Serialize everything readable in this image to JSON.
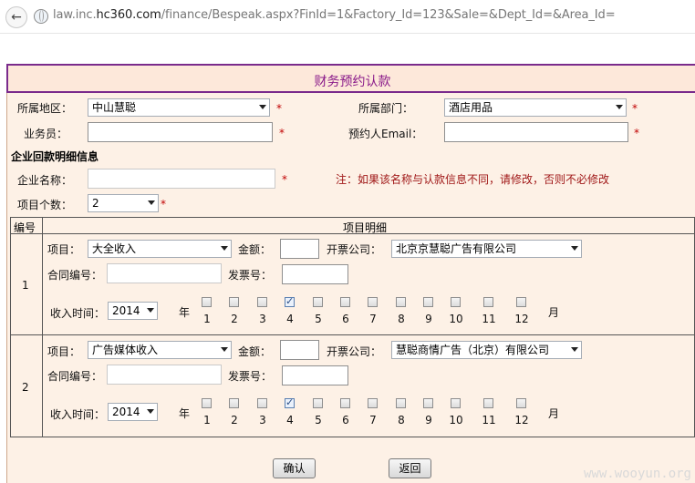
{
  "browser": {
    "url_prefix": "law.inc.",
    "url_domain": "hc360.com",
    "url_path": "/finance/Bespeak.aspx?FinId=1&Factory_Id=123&Sale=&Dept_Id=&Area_Id="
  },
  "form": {
    "title": "财务预约认款",
    "area_label": "所属地区：",
    "area_value": "中山慧聪",
    "dept_label": "所属部门：",
    "dept_value": "酒店用品",
    "sales_label": "业务员：",
    "email_label": "预约人Email：",
    "required_mark": "*",
    "section_title": "企业回款明细信息",
    "company_label": "企业名称：",
    "company_note": "注：如果该名称与认款信息不同，请修改，否则不必修改",
    "count_label": "项目个数：",
    "count_value": "2"
  },
  "table": {
    "col_no": "编号",
    "col_detail": "项目明细",
    "labels": {
      "project": "项目：",
      "amount": "金额：",
      "invoice_company": "开票公司：",
      "contract_no": "合同编号：",
      "invoice_no": "发票号：",
      "income_time": "收入时间：",
      "year": "年",
      "month": "月"
    },
    "months": [
      "1",
      "2",
      "3",
      "4",
      "5",
      "6",
      "7",
      "8",
      "9",
      "10",
      "11",
      "12"
    ],
    "rows": [
      {
        "no": "1",
        "project": "大全收入",
        "invoice_company": "北京京慧聪广告有限公司",
        "year": "2014",
        "checked_month": 4
      },
      {
        "no": "2",
        "project": "广告媒体收入",
        "invoice_company": "慧聪商情广告（北京）有限公司",
        "year": "2014",
        "checked_month": 4
      }
    ]
  },
  "buttons": {
    "confirm": "确认",
    "back": "返回"
  },
  "watermark": "www.wooyun.org"
}
